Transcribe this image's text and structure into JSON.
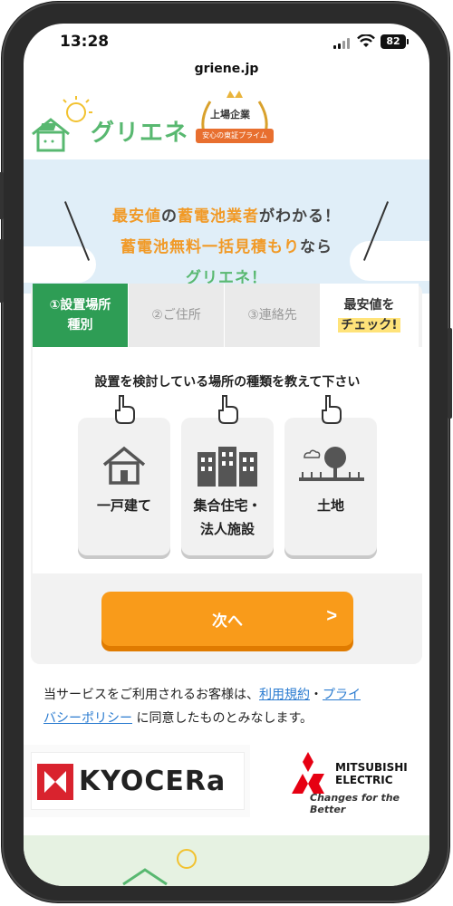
{
  "status_bar": {
    "time": "13:28",
    "battery": "82"
  },
  "browser": {
    "url": "griene.jp"
  },
  "header": {
    "logo_text": "グリエネ",
    "badge_top": "上場企業",
    "badge_ribbon": "安心の東証プライム"
  },
  "hero": {
    "line1_a": "最安値",
    "line1_b": "の",
    "line1_c": "蓄電池業者",
    "line1_d": "がわかる！",
    "line2_a": "蓄電池無料一括見積もり",
    "line2_b": "なら",
    "line3": "グリエネ！"
  },
  "steps": [
    {
      "label_1": "①設置場所",
      "label_2": "種別"
    },
    {
      "label_1": "②ご住所"
    },
    {
      "label_1": "③連絡先"
    },
    {
      "label_1": "最安値を",
      "label_2": "チェック!"
    }
  ],
  "question": "設置を検討している場所の種類を教えて下さい",
  "options": [
    {
      "label_1": "一戸建て",
      "label_2": "",
      "icon": "house-icon"
    },
    {
      "label_1": "集合住宅・",
      "label_2": "法人施設",
      "icon": "buildings-icon"
    },
    {
      "label_1": "土地",
      "label_2": "",
      "icon": "land-icon"
    }
  ],
  "next_button": {
    "label": "次へ",
    "arrow": ">"
  },
  "terms": {
    "prefix": "当サービスをご利用されるお客様は、",
    "link1": "利用規約",
    "sep": "・",
    "link2_a": "プライ",
    "link2_b": "バシーポリシー",
    "suffix": " に同意したものとみなします。"
  },
  "partners": {
    "kyocera": "KYOCERa",
    "mitsubishi_1": "MITSUBISHI",
    "mitsubishi_2": "ELECTRIC",
    "mitsubishi_tag": "Changes for the Better"
  },
  "colors": {
    "primary_green": "#2e9d55",
    "accent_orange": "#f99b1a",
    "hero_bg": "#e0eef8"
  }
}
